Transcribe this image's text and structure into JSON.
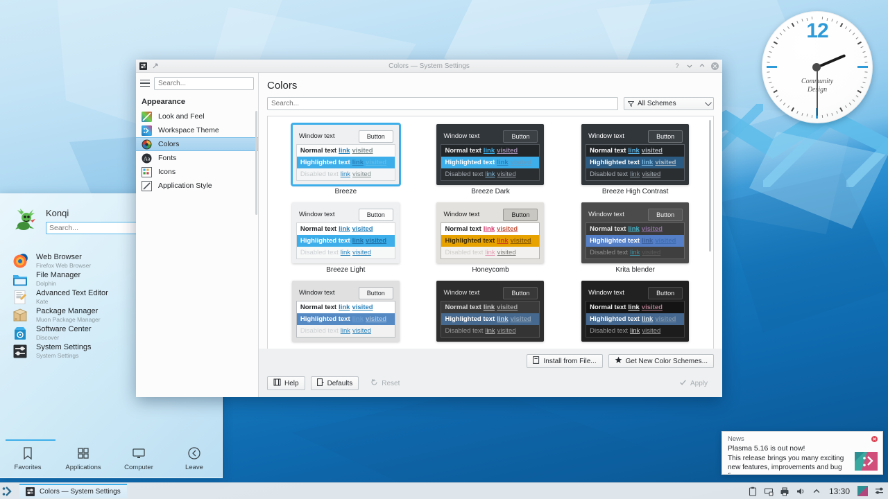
{
  "desktop": {
    "wallpaper_name": "Plasma Breeze blue geometric",
    "accent_color": "#3daee9",
    "wallpaper_top_color": "#cfe9f7",
    "wallpaper_bottom_color": "#0a538c"
  },
  "clock": {
    "hour_marker": "12",
    "brand_line1": "Community",
    "brand_line2": "Design",
    "marker_color": "#2e9bd8"
  },
  "launcher": {
    "user_name": "Konqi",
    "search_placeholder": "Search...",
    "search_value": "",
    "favorites": [
      {
        "name": "Web Browser",
        "sub": "Firefox Web Browser",
        "icon": "firefox-icon"
      },
      {
        "name": "File Manager",
        "sub": "Dolphin",
        "icon": "folder-icon"
      },
      {
        "name": "Advanced Text Editor",
        "sub": "Kate",
        "icon": "kate-icon"
      },
      {
        "name": "Package Manager",
        "sub": "Muon Package Manager",
        "icon": "package-icon"
      },
      {
        "name": "Software Center",
        "sub": "Discover",
        "icon": "discover-icon"
      },
      {
        "name": "System Settings",
        "sub": "System Settings",
        "icon": "systemsettings-icon"
      }
    ],
    "tabs": [
      {
        "label": "Favorites",
        "icon": "bookmark-icon",
        "active": true
      },
      {
        "label": "Applications",
        "icon": "grid-icon",
        "active": false
      },
      {
        "label": "Computer",
        "icon": "monitor-icon",
        "active": false
      },
      {
        "label": "Leave",
        "icon": "back-arrow-icon",
        "active": false
      }
    ]
  },
  "window": {
    "title": "Colors — System Settings",
    "titlebar_buttons": [
      "help-button",
      "minimize-button",
      "maximize-button",
      "close-button"
    ],
    "sidebar": {
      "search_placeholder": "Search...",
      "search_value": "",
      "category": "Appearance",
      "items": [
        {
          "label": "Look and Feel",
          "icon": "look-and-feel-icon",
          "selected": false
        },
        {
          "label": "Workspace Theme",
          "icon": "workspace-theme-icon",
          "selected": false
        },
        {
          "label": "Colors",
          "icon": "colors-icon",
          "selected": true
        },
        {
          "label": "Fonts",
          "icon": "fonts-icon",
          "selected": false
        },
        {
          "label": "Icons",
          "icon": "icons-icon",
          "selected": false
        },
        {
          "label": "Application Style",
          "icon": "application-style-icon",
          "selected": false
        }
      ]
    },
    "main": {
      "page_title": "Colors",
      "search_placeholder": "Search...",
      "search_value": "",
      "filter_label": "All Schemes",
      "row_labels": {
        "window_text": "Window text",
        "button": "Button",
        "normal": "Normal text",
        "highlighted": "Highlighted text",
        "disabled": "Disabled text",
        "link": "link",
        "visited": "visited"
      },
      "schemes": [
        {
          "name": "Breeze",
          "selected": true,
          "win_bg": "#eff0f1",
          "win_fg": "#232629",
          "btn_bg": "#fcfcfc",
          "btn_border": "#bdc3c7",
          "btn_fg": "#232629",
          "view_bg": "#fcfcfc",
          "view_border": "#d4d7d9",
          "normal_fg": "#232629",
          "normal_link": "#2980b9",
          "normal_visited": "#7f8c8d",
          "hl_bg": "#3daee9",
          "hl_fg": "#ffffff",
          "hl_link": "#2a7fb8",
          "hl_visited": "#5bbbec",
          "dis_bg": "#f4f5f6",
          "dis_fg": "#c8ccce",
          "dis_link": "#2980b9",
          "dis_visited": "#7f8c8d"
        },
        {
          "name": "Breeze Dark",
          "selected": false,
          "win_bg": "#31363b",
          "win_fg": "#eff0f1",
          "btn_bg": "#3b4045",
          "btn_border": "#5b6066",
          "btn_fg": "#eff0f1",
          "view_bg": "#232629",
          "view_border": "#4b5157",
          "normal_fg": "#eff0f1",
          "normal_link": "#3daee9",
          "normal_visited": "#9b8baa",
          "hl_bg": "#3daee9",
          "hl_fg": "#ffffff",
          "hl_link": "#2a7fb8",
          "hl_visited": "#5c9fc9",
          "dis_bg": "#2b2e31",
          "dis_fg": "#a1a9b1",
          "dis_link": "#7fb9dd",
          "dis_visited": "#9aa3ab"
        },
        {
          "name": "Breeze High Contrast",
          "selected": false,
          "win_bg": "#31363b",
          "win_fg": "#ffffff",
          "btn_bg": "#3b4045",
          "btn_border": "#6b7075",
          "btn_fg": "#ffffff",
          "view_bg": "#232629",
          "view_border": "#555b61",
          "normal_fg": "#ffffff",
          "normal_link": "#5ab0e0",
          "normal_visited": "#a9b0b6",
          "hl_bg": "#2b5b82",
          "hl_fg": "#ffffff",
          "hl_link": "#79b4dd",
          "hl_visited": "#b0bcc6",
          "dis_bg": "#2b2e31",
          "dis_fg": "#a8b0b7",
          "dis_link": "#8b9aa5",
          "dis_visited": "#a8b0b7"
        },
        {
          "name": "Breeze Light",
          "selected": false,
          "win_bg": "#eff0f1",
          "win_fg": "#232629",
          "btn_bg": "#fcfcfc",
          "btn_border": "#bdc3c7",
          "btn_fg": "#232629",
          "view_bg": "#ffffff",
          "view_border": "#d4d7d9",
          "normal_fg": "#232629",
          "normal_link": "#2980b9",
          "normal_visited": "#2980b9",
          "hl_bg": "#3daee9",
          "hl_fg": "#ffffff",
          "hl_link": "#1f6fa5",
          "hl_visited": "#1f6fa5",
          "dis_bg": "#f7f8f8",
          "dis_fg": "#cdd1d4",
          "dis_link": "#2980b9",
          "dis_visited": "#2980b9"
        },
        {
          "name": "Honeycomb",
          "selected": false,
          "win_bg": "#e3e1dd",
          "win_fg": "#1c1c1c",
          "btn_bg": "#c9c7c2",
          "btn_border": "#9a9893",
          "btn_fg": "#1c1c1c",
          "view_bg": "#ffffff",
          "view_border": "#b5b3ae",
          "normal_fg": "#1c1c1c",
          "normal_link": "#d6376b",
          "normal_visited": "#c4553f",
          "hl_bg": "#e8a200",
          "hl_fg": "#3b2a00",
          "hl_link": "#c93a1e",
          "hl_visited": "#8a5a00",
          "dis_bg": "#f2f1ef",
          "dis_fg": "#cfcdc9",
          "dis_link": "#e39ab2",
          "dis_visited": "#7d7b77"
        },
        {
          "name": "Krita blender",
          "selected": false,
          "win_bg": "#4b4b4b",
          "win_fg": "#e8e8e8",
          "btn_bg": "#555555",
          "btn_border": "#6e6e6e",
          "btn_fg": "#f0f0f0",
          "view_bg": "#3a3a3a",
          "view_border": "#636363",
          "normal_fg": "#e8e8e8",
          "normal_link": "#47b3c8",
          "normal_visited": "#8c6f9e",
          "hl_bg": "#5580c8",
          "hl_fg": "#ffffff",
          "hl_link": "#3b5f9b",
          "hl_visited": "#3f6cb0",
          "dis_bg": "#3f3f3f",
          "dis_fg": "#8f8f8f",
          "dis_link": "#3f8d9d",
          "dis_visited": "#5a5a5a"
        },
        {
          "name": "",
          "selected": false,
          "win_bg": "#e0e0e0",
          "win_fg": "#232629",
          "btn_bg": "#f3f3f3",
          "btn_border": "#b4b8bb",
          "btn_fg": "#232629",
          "view_bg": "#ffffff",
          "view_border": "#b9bdc0",
          "normal_fg": "#232629",
          "normal_link": "#2980b9",
          "normal_visited": "#2980b9",
          "hl_bg": "#5489c4",
          "hl_fg": "#ffffff",
          "hl_link": "#6f9ed0",
          "hl_visited": "#a8c3e0",
          "dis_bg": "#f2f2f2",
          "dis_fg": "#cdd1d4",
          "dis_link": "#2980b9",
          "dis_visited": "#2980b9"
        },
        {
          "name": "",
          "selected": false,
          "win_bg": "#2e2e2e",
          "win_fg": "#dcdcdc",
          "btn_bg": "#383838",
          "btn_border": "#585858",
          "btn_fg": "#eaeaea",
          "view_bg": "#3a3a3a",
          "view_border": "#555555",
          "normal_fg": "#dcdcdc",
          "normal_link": "#cfcfcf",
          "normal_visited": "#a7a7a7",
          "hl_bg": "#46698f",
          "hl_fg": "#ffffff",
          "hl_link": "#cdd8e2",
          "hl_visited": "#8da2b6",
          "dis_bg": "#343434",
          "dis_fg": "#9b9b9b",
          "dis_link": "#bcbcbc",
          "dis_visited": "#9b9b9b"
        },
        {
          "name": "",
          "selected": false,
          "win_bg": "#212121",
          "win_fg": "#f0f0f0",
          "btn_bg": "#2b2b2b",
          "btn_border": "#4c4c4c",
          "btn_fg": "#f0f0f0",
          "view_bg": "#141414",
          "view_border": "#3d3d3d",
          "normal_fg": "#f0f0f0",
          "normal_link": "#f0f0f0",
          "normal_visited": "#b07b8e",
          "hl_bg": "#44688f",
          "hl_fg": "#ffffff",
          "hl_link": "#d9e4ee",
          "hl_visited": "#7e93a8",
          "dis_bg": "#1c1c1c",
          "dis_fg": "#9a9a9a",
          "dis_link": "#cfcfcf",
          "dis_visited": "#9a9a9a"
        }
      ],
      "actions": {
        "install_from_file": "Install from File...",
        "get_new": "Get New Color Schemes..."
      },
      "footer": {
        "help": "Help",
        "defaults": "Defaults",
        "reset": "Reset",
        "apply": "Apply"
      }
    }
  },
  "notification": {
    "source": "News",
    "headline": "Plasma 5.16 is out now!",
    "body": "This release brings you many exciting new features, improvements and bug fixes.",
    "close_icon": "close-icon"
  },
  "panel": {
    "launcher_icon": "plasma-launcher-icon",
    "task": {
      "label": "Colors — System Settings",
      "icon": "systemsettings-icon",
      "active": true
    },
    "tray_icons": [
      "clipboard-icon",
      "device-notifier-icon",
      "printer-icon",
      "volume-icon",
      "show-hidden-icon"
    ],
    "clock": "13:30",
    "extra_icons": [
      "pager-icon",
      "settings-icon"
    ]
  }
}
